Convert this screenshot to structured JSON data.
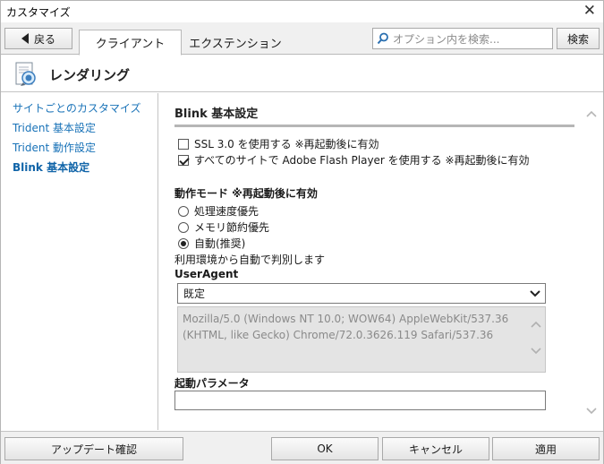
{
  "window": {
    "title": "カスタマイズ",
    "close_glyph": "✕"
  },
  "toolbar": {
    "back_label": "戻る",
    "tabs": [
      {
        "label": "クライアント",
        "active": true
      },
      {
        "label": "エクステンション",
        "active": false
      }
    ],
    "search": {
      "placeholder": "オプション内を検索...",
      "icon": "search-icon"
    },
    "search_button": "検索"
  },
  "section": {
    "title": "レンダリング",
    "icon": "rendering-icon"
  },
  "sidebar": {
    "items": [
      {
        "label": "サイトごとのカスタマイズ",
        "selected": false
      },
      {
        "label": "Trident 基本設定",
        "selected": false
      },
      {
        "label": "Trident 動作設定",
        "selected": false
      },
      {
        "label": "Blink 基本設定",
        "selected": true
      }
    ]
  },
  "content": {
    "title": "Blink 基本設定",
    "checkboxes": [
      {
        "label": "SSL 3.0 を使用する ※再起動後に有効",
        "checked": false
      },
      {
        "label": "すべてのサイトで Adobe Flash Player を使用する ※再起動後に有効",
        "checked": true
      }
    ],
    "mode": {
      "label": "動作モード ※再起動後に有効",
      "options": [
        {
          "label": "処理速度優先",
          "selected": false
        },
        {
          "label": "メモリ節約優先",
          "selected": false
        },
        {
          "label": "自動(推奨)",
          "selected": true
        }
      ],
      "note": "利用環境から自動で判別します"
    },
    "useragent": {
      "label": "UserAgent",
      "selected": "既定",
      "line1": "Mozilla/5.0 (Windows NT 10.0; WOW64) AppleWebKit/537.36",
      "line2": "(KHTML, like Gecko) Chrome/72.0.3626.119 Safari/537.36"
    },
    "launch_params": {
      "label": "起動パラメータ",
      "value": ""
    }
  },
  "footer": {
    "update_check": "アップデート確認",
    "ok": "OK",
    "cancel": "キャンセル",
    "apply": "適用"
  },
  "colors": {
    "link": "#1a73b8",
    "link_selected": "#1064a8",
    "chrome_bg": "#f0f0f0"
  }
}
